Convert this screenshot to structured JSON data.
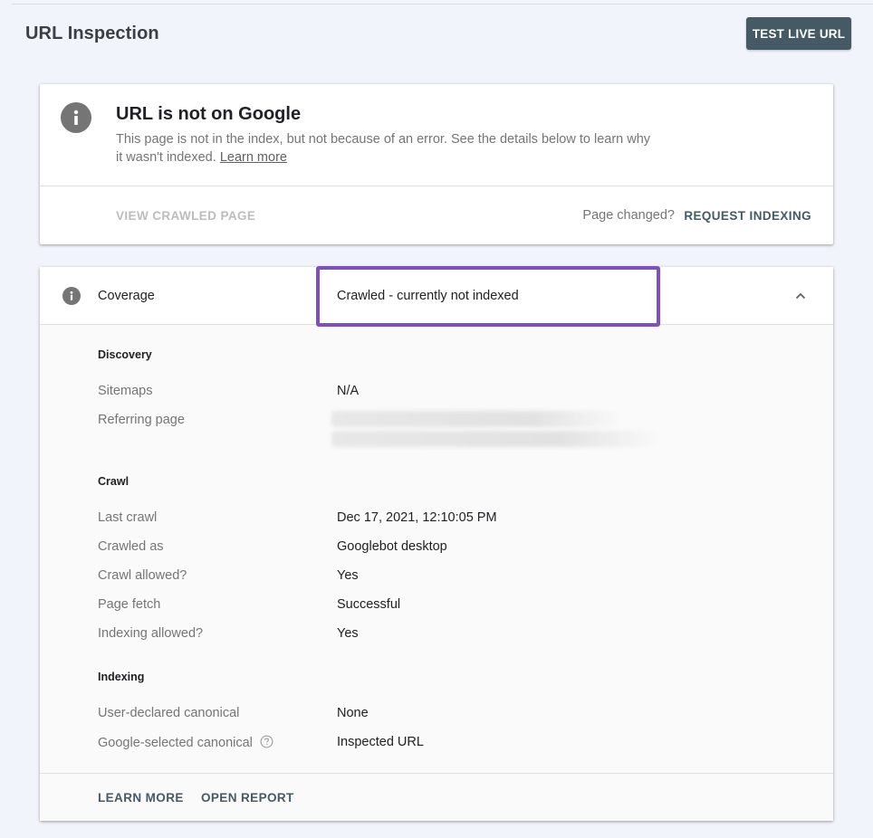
{
  "header": {
    "title": "URL Inspection",
    "test_live_url_label": "TEST LIVE URL"
  },
  "status_card": {
    "icon": "info-icon",
    "title": "URL is not on Google",
    "description": "This page is not in the index, but not because of an error. See the details below to learn why it wasn't indexed.",
    "learn_more_link": "Learn more",
    "view_crawled_page_label": "VIEW CRAWLED PAGE",
    "page_changed_text": "Page changed?",
    "request_indexing_label": "REQUEST INDEXING"
  },
  "coverage": {
    "icon": "info-icon",
    "label": "Coverage",
    "value": "Crawled - currently not indexed",
    "highlight_color": "#7e4ec2",
    "expand_icon": "chevron-up-icon",
    "sections": {
      "discovery": {
        "title": "Discovery",
        "rows": [
          {
            "label": "Sitemaps",
            "value": "N/A"
          },
          {
            "label": "Referring page",
            "value": ""
          }
        ]
      },
      "crawl": {
        "title": "Crawl",
        "rows": [
          {
            "label": "Last crawl",
            "value": "Dec 17, 2021, 12:10:05 PM"
          },
          {
            "label": "Crawled as",
            "value": "Googlebot desktop"
          },
          {
            "label": "Crawl allowed?",
            "value": "Yes"
          },
          {
            "label": "Page fetch",
            "value": "Successful"
          },
          {
            "label": "Indexing allowed?",
            "value": "Yes"
          }
        ]
      },
      "indexing": {
        "title": "Indexing",
        "rows": [
          {
            "label": "User-declared canonical",
            "value": "None"
          },
          {
            "label": "Google-selected canonical",
            "value": "Inspected URL",
            "help_icon": "help-circle-icon"
          }
        ]
      }
    },
    "footer": {
      "learn_more_label": "LEARN MORE",
      "open_report_label": "OPEN REPORT"
    }
  },
  "colors": {
    "background": "#f1f4fb",
    "primary_button": "#455a64",
    "highlight": "#7e4ec2"
  }
}
